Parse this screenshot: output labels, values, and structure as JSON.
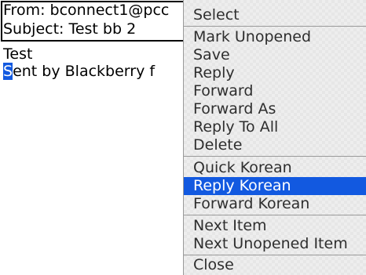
{
  "email": {
    "from": "From: bconnect1@pcc",
    "subject": "Subject: Test bb 2",
    "body_line1": "Test",
    "body_line2_cursor": "S",
    "body_line2_rest": "ent by Blackberry f"
  },
  "menu": {
    "items": [
      {
        "label": "Select"
      },
      {
        "label": "Mark Unopened"
      },
      {
        "label": "Save"
      },
      {
        "label": "Reply"
      },
      {
        "label": "Forward"
      },
      {
        "label": "Forward As"
      },
      {
        "label": "Reply To All"
      },
      {
        "label": "Delete"
      },
      {
        "label": "Quick Korean"
      },
      {
        "label": "Reply Korean",
        "selected": true
      },
      {
        "label": "Forward Korean"
      },
      {
        "label": "Next Item"
      },
      {
        "label": "Next Unopened Item"
      },
      {
        "label": "Close"
      }
    ]
  },
  "colors": {
    "selection": "#1259e0",
    "menu_background": "#eeeeee",
    "menu_text": "#2e2e2e"
  }
}
